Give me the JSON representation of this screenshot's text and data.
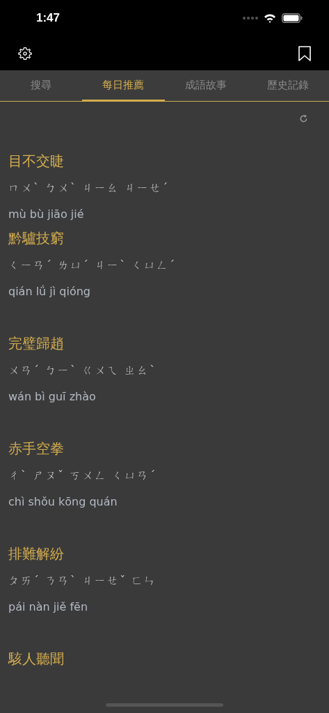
{
  "status_bar": {
    "time": "1:47"
  },
  "tabs": [
    {
      "label": "搜尋",
      "selected": false
    },
    {
      "label": "每日推薦",
      "selected": true
    },
    {
      "label": "成語故事",
      "selected": false
    },
    {
      "label": "歷史記錄",
      "selected": false
    }
  ],
  "idioms": [
    {
      "title": "目不交睫",
      "zhuyin": "ㄇㄨˋ ㄅㄨˋ ㄐㄧㄠ ㄐㄧㄝˊ",
      "pinyin": "mù bù jiāo jié"
    },
    {
      "title": "黔驢技窮",
      "zhuyin": "ㄑㄧㄢˊ ㄌㄩˊ ㄐㄧˋ ㄑㄩㄥˊ",
      "pinyin": "qián lǘ jì qióng"
    },
    {
      "title": "完璧歸趙",
      "zhuyin": "ㄨㄢˊ ㄅㄧˋ ㄍㄨㄟ ㄓㄠˋ",
      "pinyin": "wán bì guī zhào"
    },
    {
      "title": "赤手空拳",
      "zhuyin": "ㄔˋ ㄕㄡˇ ㄎㄨㄥ ㄑㄩㄢˊ",
      "pinyin": "chì shǒu kōng quán"
    },
    {
      "title": "排難解紛",
      "zhuyin": "ㄆㄞˊ ㄋㄢˋ ㄐㄧㄝˇ ㄈㄣ",
      "pinyin": "pái nàn jiě fēn"
    },
    {
      "title": "駭人聽聞"
    }
  ]
}
